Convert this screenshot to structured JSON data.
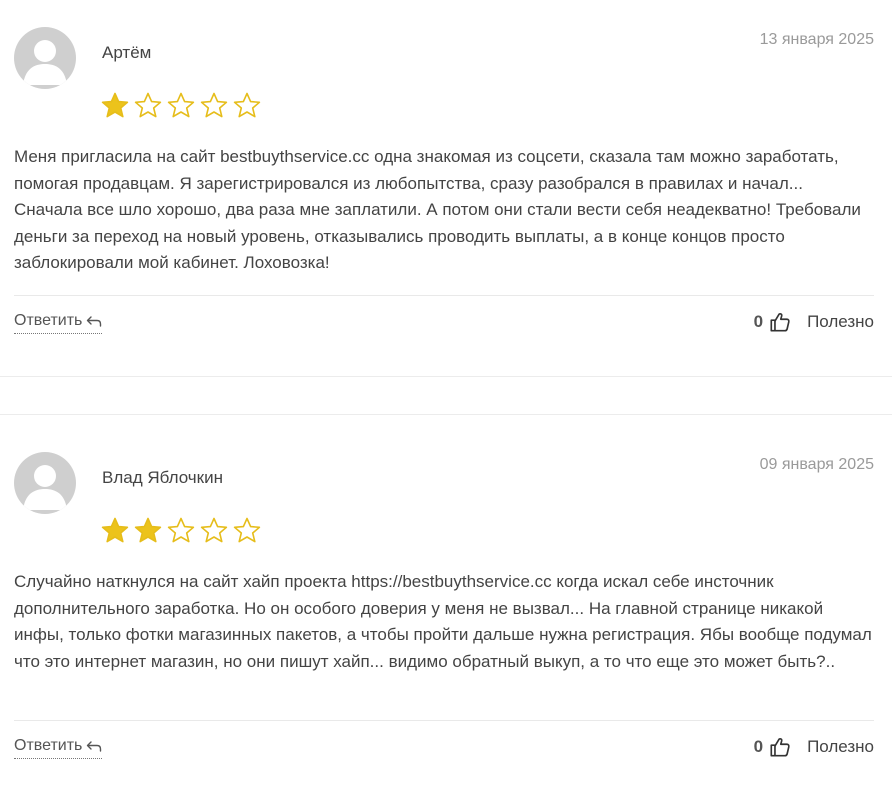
{
  "reviews": [
    {
      "author": "Артём",
      "date": "13 января 2025",
      "rating": 1,
      "max_rating": 5,
      "text": "Меня пригласила на сайт bestbuythservice.cc одна знакомая из соцсети, сказала там можно заработать, помогая продавцам. Я зарегистрировался из любопытства, сразу разобрался в правилах и начал... Сначала все шло хорошо, два раза мне заплатили. А потом они стали вести себя неадекватно! Требовали деньги за переход на новый уровень, отказывались проводить выплаты, а в конце концов просто заблокировали мой кабинет. Лоховозка!",
      "reply_label": "Ответить",
      "useful_count": "0",
      "useful_label": "Полезно"
    },
    {
      "author": "Влад Яблочкин",
      "date": "09 января 2025",
      "rating": 2,
      "max_rating": 5,
      "text": "Случайно наткнулся на сайт хайп проекта https://bestbuythservice.cc когда искал себе инсточник дополнительного заработка. Но он особого доверия у меня не вызвал... На главной странице никакой инфы, только фотки магазинных пакетов, а чтобы пройти дальше нужна регистрация. Ябы вообще подумал что это интернет магазин, но они пишут хайп... видимо обратный выкуп, а то что еще это может быть?..",
      "reply_label": "Ответить",
      "useful_count": "0",
      "useful_label": "Полезно"
    }
  ],
  "colors": {
    "star_filled": "#ecc31b",
    "star_stroke": "#e6bd1a",
    "avatar_bg": "#cfcfcf",
    "avatar_fg": "#ffffff"
  },
  "icons": {
    "avatar": "user-silhouette-icon",
    "star": "star-icon",
    "reply": "reply-arrow-icon",
    "like": "thumbs-up-icon"
  }
}
